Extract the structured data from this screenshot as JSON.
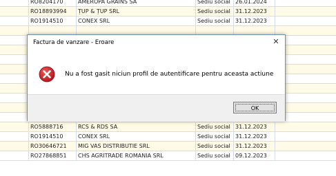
{
  "background_rows": [
    {
      "fiscal_code": "RO8204170",
      "company": "AMEROPA GRAINS SA",
      "office": "Sediu social",
      "date": "26.01.2024"
    },
    {
      "fiscal_code": "RO18893994",
      "company": "ȚUP & ȚUP SRL",
      "office": "Sediu social",
      "date": "31.12.2023"
    },
    {
      "fiscal_code": "RO1914510",
      "company": "CONEX SRL",
      "office": "Sediu social",
      "date": "31.12.2023"
    },
    {
      "fiscal_code": "",
      "company": "",
      "office": "",
      "date": ""
    },
    {
      "fiscal_code": "",
      "company": "",
      "office": "",
      "date": ""
    },
    {
      "fiscal_code": "",
      "company": "",
      "office": "",
      "date": ""
    },
    {
      "fiscal_code": "",
      "company": "",
      "office": "",
      "date": ""
    },
    {
      "fiscal_code": "",
      "company": "",
      "office": "",
      "date": ""
    },
    {
      "fiscal_code": "",
      "company": "",
      "office": "",
      "date": ""
    },
    {
      "fiscal_code": "",
      "company": "",
      "office": "",
      "date": ""
    },
    {
      "fiscal_code": "",
      "company": "",
      "office": "",
      "date": ""
    },
    {
      "fiscal_code": "",
      "company": "",
      "office": "",
      "date": ""
    },
    {
      "fiscal_code": "RO1914510",
      "company": "CONEX SRL",
      "office": "Sediu social",
      "date": "31.12.2023"
    },
    {
      "fiscal_code": "RO5888716",
      "company": "RCS & RDS SA",
      "office": "Sediu social",
      "date": "31.12.2023"
    },
    {
      "fiscal_code": "RO1914510",
      "company": "CONEX SRL",
      "office": "Sediu social",
      "date": "31.12.2023"
    },
    {
      "fiscal_code": "RO30646721",
      "company": "MIG VAS DISTRIBUTIE SRL",
      "office": "Sediu social",
      "date": "31.12.2023"
    },
    {
      "fiscal_code": "RO27868851",
      "company": "CHS AGRITRADE ROMANIA SRL",
      "office": "Sediu social",
      "date": "09.12.2023"
    }
  ],
  "dialog": {
    "title": "Factura de vanzare - Eroare",
    "close_glyph": "✕",
    "message": "Nu a fost gasit niciun profil de autentificare pentru aceasta actiune",
    "icon": "error-icon",
    "ok_label": "OK"
  },
  "colors": {
    "row_alt": "#fffbe6",
    "error_red": "#c0161b",
    "dialog_border": "#6f8fb8"
  }
}
